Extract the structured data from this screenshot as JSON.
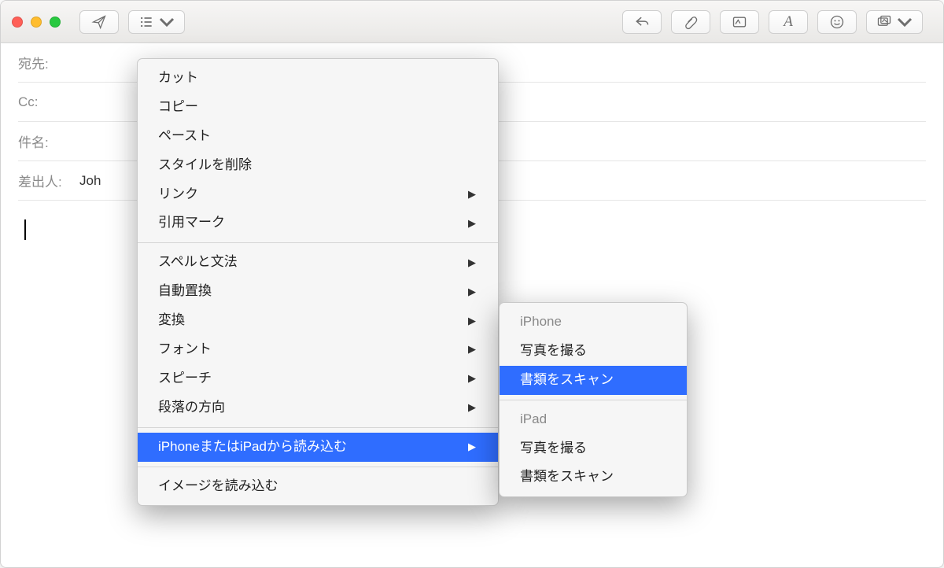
{
  "headers": {
    "to_label": "宛先:",
    "cc_label": "Cc:",
    "subject_label": "件名:",
    "from_label": "差出人:",
    "from_value": "Joh"
  },
  "context_menu": {
    "cut": "カット",
    "copy": "コピー",
    "paste": "ペースト",
    "clear_style": "スタイルを削除",
    "link": "リンク",
    "quote_mark": "引用マーク",
    "spell_grammar": "スペルと文法",
    "auto_replace": "自動置換",
    "transform": "変換",
    "font": "フォント",
    "speech": "スピーチ",
    "paragraph_dir": "段落の方向",
    "import_from_iphone": "iPhoneまたはiPadから読み込む",
    "import_image": "イメージを読み込む"
  },
  "submenu": {
    "iphone_header": "iPhone",
    "take_photo": "写真を撮る",
    "scan_doc": "書類をスキャン",
    "ipad_header": "iPad",
    "take_photo2": "写真を撮る",
    "scan_doc2": "書類をスキャン"
  }
}
